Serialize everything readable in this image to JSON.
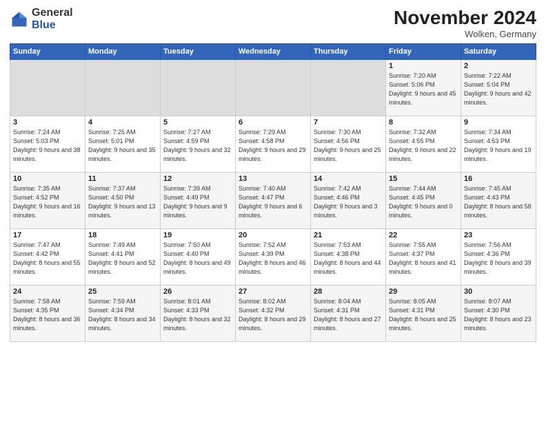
{
  "header": {
    "logo_general": "General",
    "logo_blue": "Blue",
    "month_title": "November 2024",
    "location": "Wolken, Germany"
  },
  "weekdays": [
    "Sunday",
    "Monday",
    "Tuesday",
    "Wednesday",
    "Thursday",
    "Friday",
    "Saturday"
  ],
  "weeks": [
    [
      {
        "day": "",
        "info": ""
      },
      {
        "day": "",
        "info": ""
      },
      {
        "day": "",
        "info": ""
      },
      {
        "day": "",
        "info": ""
      },
      {
        "day": "",
        "info": ""
      },
      {
        "day": "1",
        "info": "Sunrise: 7:20 AM\nSunset: 5:06 PM\nDaylight: 9 hours and 45 minutes."
      },
      {
        "day": "2",
        "info": "Sunrise: 7:22 AM\nSunset: 5:04 PM\nDaylight: 9 hours and 42 minutes."
      }
    ],
    [
      {
        "day": "3",
        "info": "Sunrise: 7:24 AM\nSunset: 5:03 PM\nDaylight: 9 hours and 38 minutes."
      },
      {
        "day": "4",
        "info": "Sunrise: 7:25 AM\nSunset: 5:01 PM\nDaylight: 9 hours and 35 minutes."
      },
      {
        "day": "5",
        "info": "Sunrise: 7:27 AM\nSunset: 4:59 PM\nDaylight: 9 hours and 32 minutes."
      },
      {
        "day": "6",
        "info": "Sunrise: 7:29 AM\nSunset: 4:58 PM\nDaylight: 9 hours and 29 minutes."
      },
      {
        "day": "7",
        "info": "Sunrise: 7:30 AM\nSunset: 4:56 PM\nDaylight: 9 hours and 25 minutes."
      },
      {
        "day": "8",
        "info": "Sunrise: 7:32 AM\nSunset: 4:55 PM\nDaylight: 9 hours and 22 minutes."
      },
      {
        "day": "9",
        "info": "Sunrise: 7:34 AM\nSunset: 4:53 PM\nDaylight: 9 hours and 19 minutes."
      }
    ],
    [
      {
        "day": "10",
        "info": "Sunrise: 7:35 AM\nSunset: 4:52 PM\nDaylight: 9 hours and 16 minutes."
      },
      {
        "day": "11",
        "info": "Sunrise: 7:37 AM\nSunset: 4:50 PM\nDaylight: 9 hours and 13 minutes."
      },
      {
        "day": "12",
        "info": "Sunrise: 7:39 AM\nSunset: 4:49 PM\nDaylight: 9 hours and 9 minutes."
      },
      {
        "day": "13",
        "info": "Sunrise: 7:40 AM\nSunset: 4:47 PM\nDaylight: 9 hours and 6 minutes."
      },
      {
        "day": "14",
        "info": "Sunrise: 7:42 AM\nSunset: 4:46 PM\nDaylight: 9 hours and 3 minutes."
      },
      {
        "day": "15",
        "info": "Sunrise: 7:44 AM\nSunset: 4:45 PM\nDaylight: 9 hours and 0 minutes."
      },
      {
        "day": "16",
        "info": "Sunrise: 7:45 AM\nSunset: 4:43 PM\nDaylight: 8 hours and 58 minutes."
      }
    ],
    [
      {
        "day": "17",
        "info": "Sunrise: 7:47 AM\nSunset: 4:42 PM\nDaylight: 8 hours and 55 minutes."
      },
      {
        "day": "18",
        "info": "Sunrise: 7:49 AM\nSunset: 4:41 PM\nDaylight: 8 hours and 52 minutes."
      },
      {
        "day": "19",
        "info": "Sunrise: 7:50 AM\nSunset: 4:40 PM\nDaylight: 8 hours and 49 minutes."
      },
      {
        "day": "20",
        "info": "Sunrise: 7:52 AM\nSunset: 4:39 PM\nDaylight: 8 hours and 46 minutes."
      },
      {
        "day": "21",
        "info": "Sunrise: 7:53 AM\nSunset: 4:38 PM\nDaylight: 8 hours and 44 minutes."
      },
      {
        "day": "22",
        "info": "Sunrise: 7:55 AM\nSunset: 4:37 PM\nDaylight: 8 hours and 41 minutes."
      },
      {
        "day": "23",
        "info": "Sunrise: 7:56 AM\nSunset: 4:36 PM\nDaylight: 8 hours and 39 minutes."
      }
    ],
    [
      {
        "day": "24",
        "info": "Sunrise: 7:58 AM\nSunset: 4:35 PM\nDaylight: 8 hours and 36 minutes."
      },
      {
        "day": "25",
        "info": "Sunrise: 7:59 AM\nSunset: 4:34 PM\nDaylight: 8 hours and 34 minutes."
      },
      {
        "day": "26",
        "info": "Sunrise: 8:01 AM\nSunset: 4:33 PM\nDaylight: 8 hours and 32 minutes."
      },
      {
        "day": "27",
        "info": "Sunrise: 8:02 AM\nSunset: 4:32 PM\nDaylight: 8 hours and 29 minutes."
      },
      {
        "day": "28",
        "info": "Sunrise: 8:04 AM\nSunset: 4:31 PM\nDaylight: 8 hours and 27 minutes."
      },
      {
        "day": "29",
        "info": "Sunrise: 8:05 AM\nSunset: 4:31 PM\nDaylight: 8 hours and 25 minutes."
      },
      {
        "day": "30",
        "info": "Sunrise: 8:07 AM\nSunset: 4:30 PM\nDaylight: 8 hours and 23 minutes."
      }
    ]
  ]
}
